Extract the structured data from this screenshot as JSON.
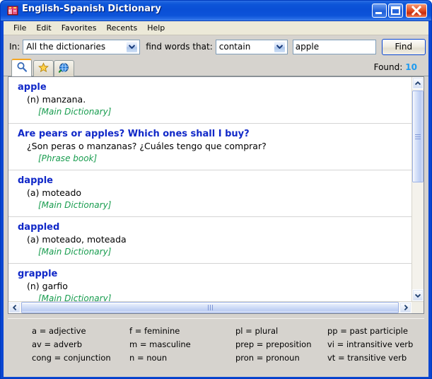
{
  "window": {
    "title": "English-Spanish Dictionary",
    "icon": "dictionary-app-icon",
    "controls": {
      "minimize": "minimize-icon",
      "maximize": "maximize-icon",
      "close": "close-icon"
    }
  },
  "menu": {
    "items": [
      {
        "label": "File"
      },
      {
        "label": "Edit"
      },
      {
        "label": "Favorites"
      },
      {
        "label": "Recents"
      },
      {
        "label": "Help"
      }
    ]
  },
  "search": {
    "in_label": "In:",
    "dictionary_value": "All the dictionaries",
    "find_words_label": "find words that:",
    "match_mode_value": "contain",
    "word_value": "apple",
    "word_placeholder": "",
    "find_button_label": "Find"
  },
  "tabs": {
    "items": [
      {
        "name": "search",
        "icon": "magnifier-icon",
        "active": true
      },
      {
        "name": "favorites",
        "icon": "star-icon",
        "active": false
      },
      {
        "name": "web",
        "icon": "globe-icon",
        "active": false
      }
    ],
    "found_label": "Found:",
    "found_count": "10"
  },
  "results": [
    {
      "headword": "apple",
      "definition": "(n) manzana.",
      "source": "[Main Dictionary]"
    },
    {
      "headword": "Are pears or apples? Which ones shall I buy?",
      "definition": "¿Son peras o manzanas? ¿Cuáles tengo que comprar?",
      "source": "[Phrase book]"
    },
    {
      "headword": "dapple",
      "definition": "(a) moteado",
      "source": "[Main Dictionary]"
    },
    {
      "headword": "dappled",
      "definition": "(a) moteado, moteada",
      "source": "[Main Dictionary]"
    },
    {
      "headword": "grapple",
      "definition": "(n) garfio",
      "source": "[Main Dictionary]"
    }
  ],
  "legend": {
    "columns": [
      {
        "lines": [
          "a = adjective",
          "av = adverb",
          "cong = conjunction"
        ]
      },
      {
        "lines": [
          "f = feminine",
          "m = masculine",
          "n = noun"
        ]
      },
      {
        "lines": [
          "pl = plural",
          "prep = preposition",
          "pron = pronoun"
        ]
      },
      {
        "lines": [
          "pp = past participle",
          "vi = intransitive verb",
          "vt = transitive verb"
        ]
      }
    ]
  },
  "colors": {
    "titlebar": "#0a4fd6",
    "headword": "#1028c8",
    "source": "#179c4e",
    "found_count": "#1e9bf0",
    "client_bg": "#d6d3ce"
  }
}
